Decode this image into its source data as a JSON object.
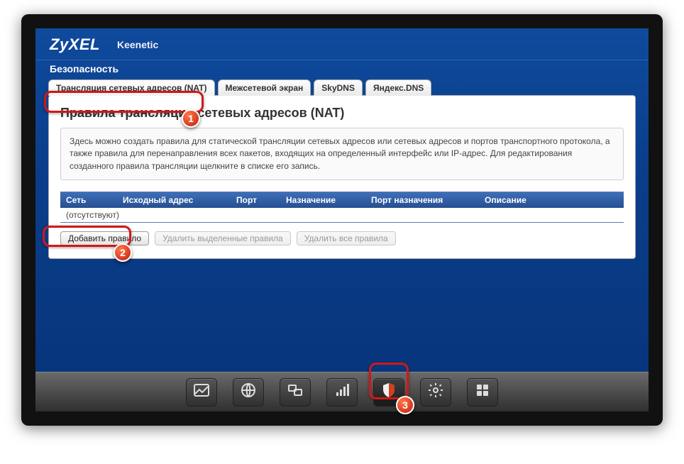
{
  "header": {
    "brand": "ZyXEL",
    "model": "Keenetic"
  },
  "section_title": "Безопасность",
  "tabs": [
    {
      "label": "Трансляция сетевых адресов (NAT)"
    },
    {
      "label": "Межсетевой экран"
    },
    {
      "label": "SkyDNS"
    },
    {
      "label": "Яндекс.DNS"
    }
  ],
  "panel": {
    "title": "Правила трансляции сетевых адресов (NAT)",
    "info": "Здесь можно создать правила для статической трансляции сетевых адресов или сетевых адресов и портов транспортного протокола, а также правила для перенаправления всех пакетов, входящих на определенный интерфейс или IP-адрес. Для редактирования созданного правила трансляции щелкните в списке его запись."
  },
  "table": {
    "columns": [
      "Сеть",
      "Исходный адрес",
      "Порт",
      "Назначение",
      "Порт назначения",
      "Описание"
    ],
    "empty_text": "(отсутствуют)"
  },
  "buttons": {
    "add": "Добавить правило",
    "delete_selected": "Удалить выделенные правила",
    "delete_all": "Удалить все правила"
  },
  "badges": {
    "one": "1",
    "two": "2",
    "three": "3"
  }
}
